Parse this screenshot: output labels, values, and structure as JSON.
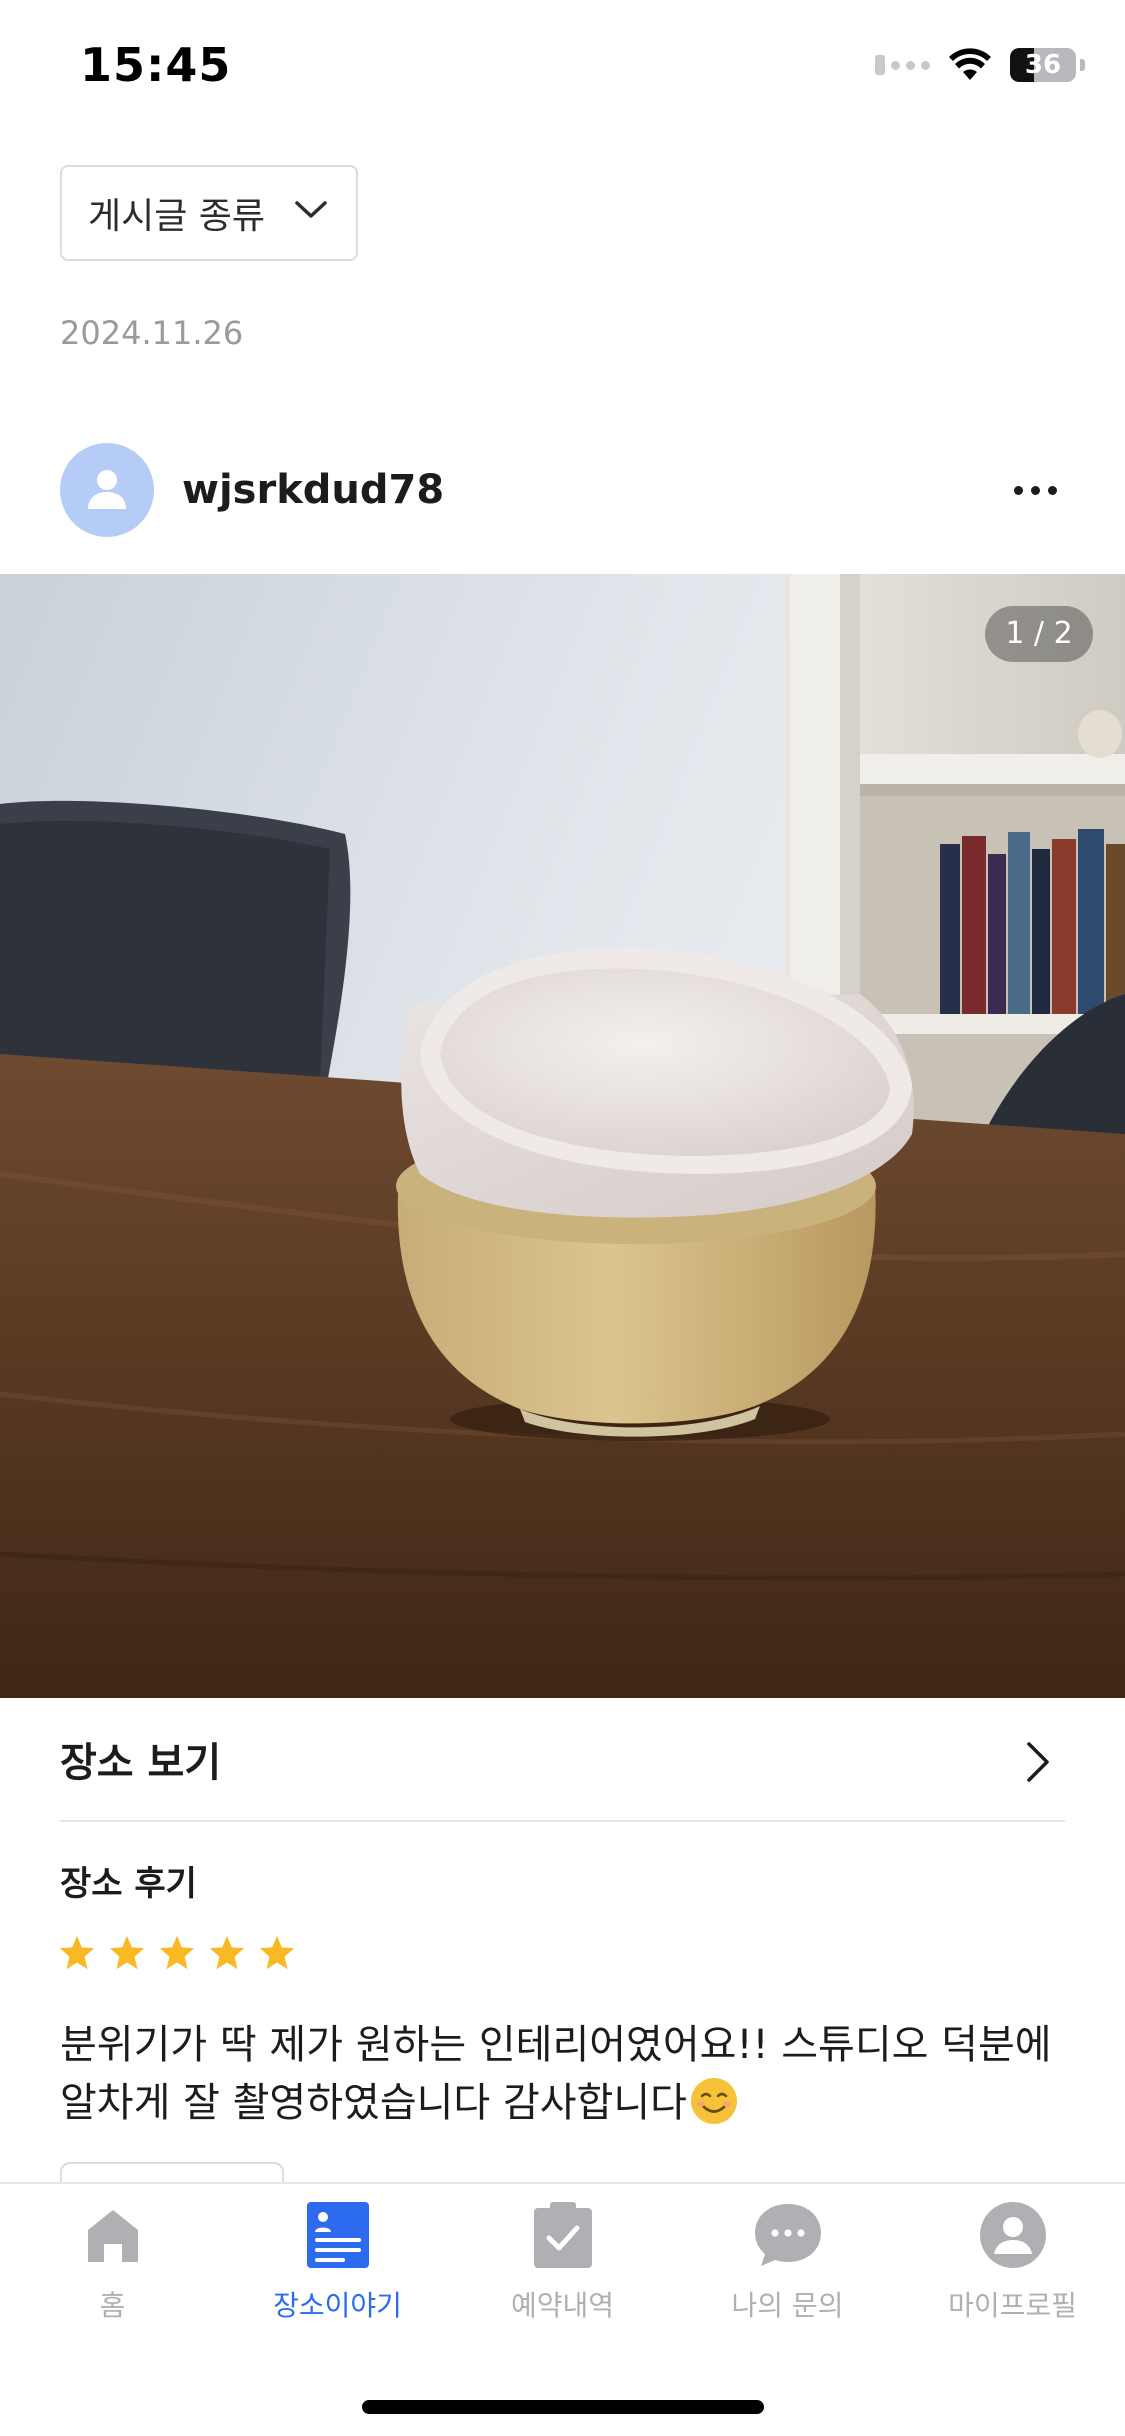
{
  "status_bar": {
    "time": "15:45",
    "battery": "36",
    "battery_level": 0.36,
    "icons": [
      "cellular-signal-icon",
      "wifi-icon",
      "battery-icon"
    ]
  },
  "filter": {
    "label": "게시글 종류",
    "icon": "chevron-down-icon"
  },
  "post": {
    "date": "2024.11.26",
    "author": "wjsrkdud78",
    "more_icon": "more-horizontal-icon",
    "image_counter": "1 / 2"
  },
  "place": {
    "view_label": "장소 보기",
    "review_title": "장소 후기",
    "rating": 5,
    "rating_max": 5,
    "star_color": "#F7B924",
    "review_text": "분위기가 딱 제가 원하는 인테리어였어요!! 스튜디오 덕분에 알차게 잘 촬영하였습니다 감사합니다"
  },
  "tab_bar": {
    "active_color": "#2C6BED",
    "inactive_color": "#B0B0B4",
    "tabs": [
      {
        "label": "홈",
        "icon": "home-icon",
        "active": false
      },
      {
        "label": "장소이야기",
        "icon": "place-story-icon",
        "active": true
      },
      {
        "label": "예약내역",
        "icon": "clipboard-check-icon",
        "active": false
      },
      {
        "label": "나의 문의",
        "icon": "chat-bubble-icon",
        "active": false
      },
      {
        "label": "마이프로필",
        "icon": "profile-icon",
        "active": false
      }
    ]
  }
}
